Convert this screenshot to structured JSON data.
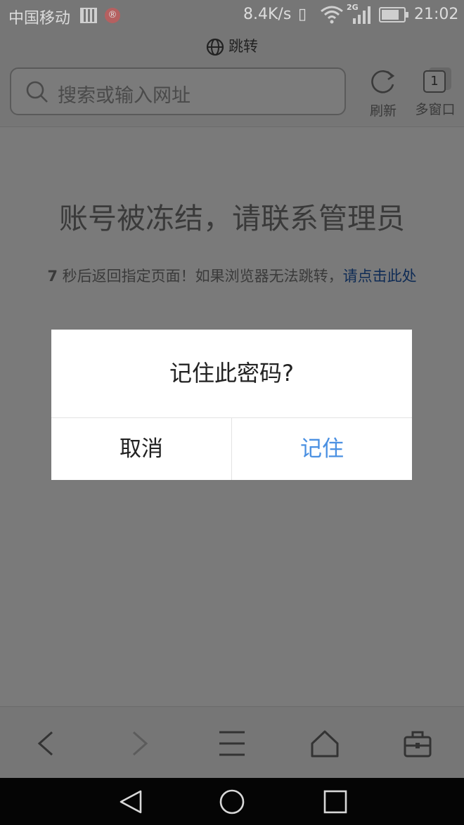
{
  "status_bar": {
    "carrier": "中国移动",
    "speed": "8.4K/s",
    "network_type": "2G",
    "time": "21:02"
  },
  "title_bar": {
    "title": "跳转"
  },
  "address_bar": {
    "placeholder": "搜索或输入网址",
    "refresh_label": "刷新",
    "windows_label": "多窗口",
    "window_count": "1"
  },
  "page": {
    "headline": "账号被冻结，请联系管理员",
    "countdown": "7",
    "redirect_text": " 秒后返回指定页面！如果浏览器无法跳转，",
    "redirect_link": "请点击此处"
  },
  "dialog": {
    "title": "记住此密码?",
    "cancel_label": "取消",
    "remember_label": "记住",
    "accent_color": "#4a90e2"
  },
  "bottom_nav": {
    "icons": [
      "back-icon",
      "forward-icon",
      "menu-icon",
      "home-icon",
      "toolbox-icon"
    ]
  },
  "system_nav": {
    "icons": [
      "system-back-icon",
      "system-home-icon",
      "system-recent-icon"
    ]
  }
}
